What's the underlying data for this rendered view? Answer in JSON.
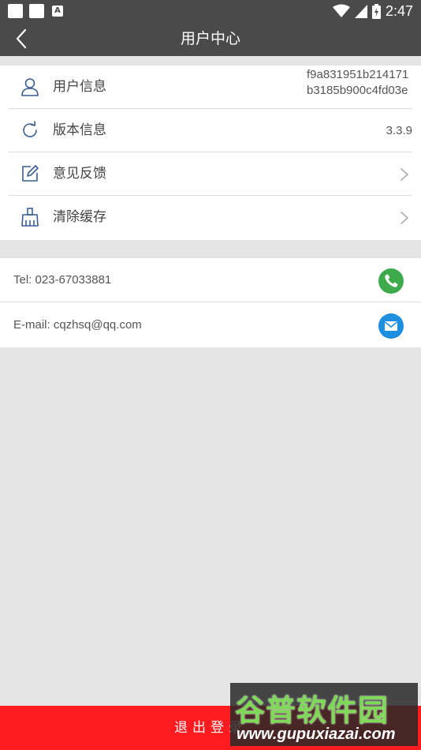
{
  "status_bar": {
    "notification_glyph": "A",
    "time": "2:47"
  },
  "header": {
    "title": "用户中心"
  },
  "menu": [
    {
      "label": "用户信息",
      "value": "f9a831951b214171b3185b900c4fd03e",
      "icon": "user-icon"
    },
    {
      "label": "版本信息",
      "value": "3.3.9",
      "icon": "refresh-icon"
    },
    {
      "label": "意见反馈",
      "icon": "edit-icon"
    },
    {
      "label": "清除缓存",
      "icon": "broom-icon"
    }
  ],
  "contact": {
    "tel": "Tel: 023-67033881",
    "email": "E-mail: cqzhsq@qq.com",
    "phone_color": "#3dab4b",
    "mail_color": "#1e8fdf"
  },
  "logout_label": "退出登录",
  "watermark": {
    "name": "谷普软件园",
    "url": "www.gupuxiazai.com"
  },
  "colors": {
    "header_bg": "#4a4a4a",
    "logout_bg": "#ff1b1f",
    "page_bg": "#e5e5e5"
  }
}
